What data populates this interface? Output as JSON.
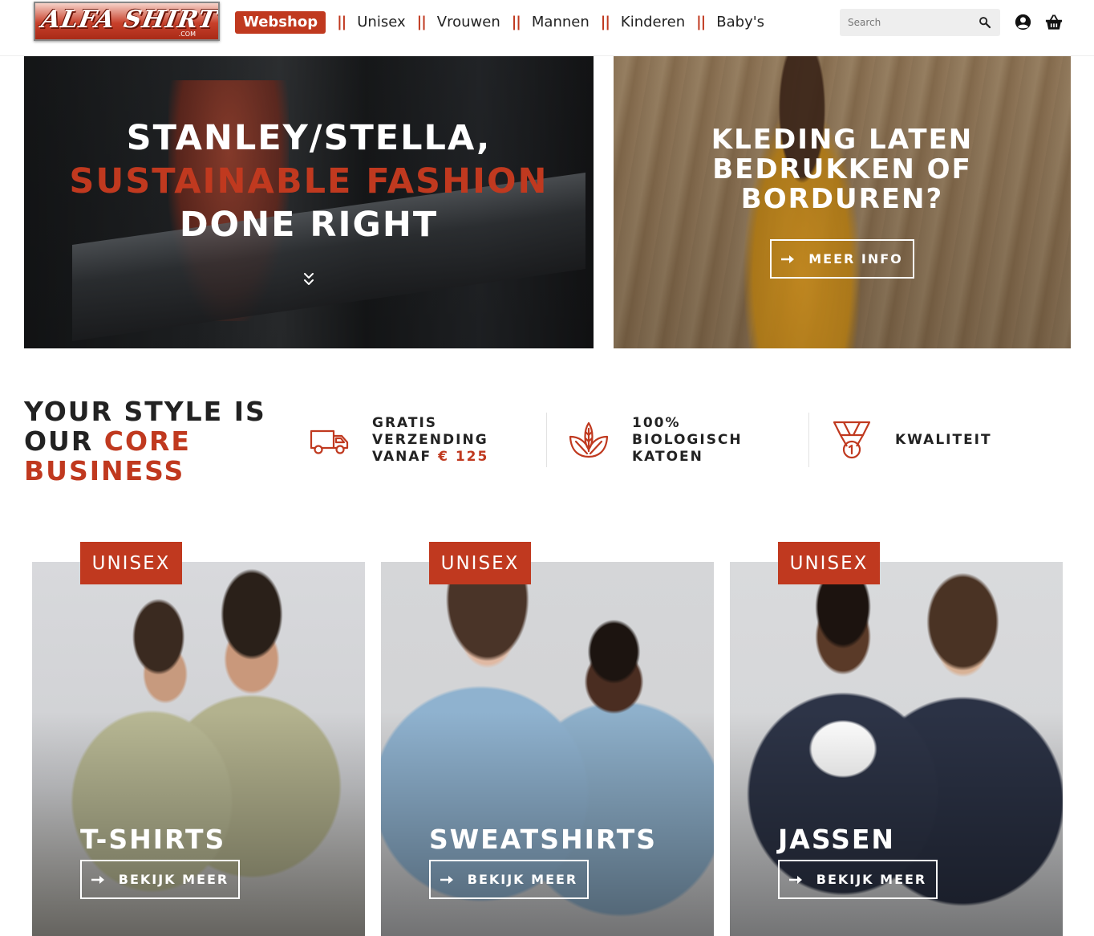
{
  "header": {
    "logo_text": "ALFA SHIRT",
    "logo_suffix": ".COM",
    "nav": [
      {
        "label": "Webshop",
        "active": true
      },
      {
        "label": "Unisex"
      },
      {
        "label": "Vrouwen"
      },
      {
        "label": "Mannen"
      },
      {
        "label": "Kinderen"
      },
      {
        "label": "Baby's"
      }
    ],
    "separator": "||",
    "search_placeholder": "Search",
    "icons": [
      "search-icon",
      "user-icon",
      "basket-icon"
    ]
  },
  "hero": {
    "left": {
      "line1": "STANLEY/STELLA,",
      "line2": "SUSTAINABLE FASHION",
      "line3": "DONE RIGHT"
    },
    "right": {
      "title_line1": "KLEDING LATEN",
      "title_line2": "BEDRUKKEN OF",
      "title_line3": "BORDUREN?",
      "button": "MEER INFO"
    }
  },
  "core": {
    "line1": "YOUR STYLE IS",
    "line2_dark": "OUR ",
    "line2_orange": "CORE",
    "line3_orange": "BUSINESS"
  },
  "features": [
    {
      "icon": "truck-icon",
      "line1": "GRATIS",
      "line2": "VERZENDING",
      "line3_dark": "VANAF ",
      "line3_orange": "€ 125"
    },
    {
      "icon": "leaf-icon",
      "line1": "100%",
      "line2": "BIOLOGISCH",
      "line3": "KATOEN"
    },
    {
      "icon": "medal-icon",
      "line1": "KWALITEIT"
    }
  ],
  "categories": [
    {
      "badge": "UNISEX",
      "title": "T-SHIRTS",
      "button": "BEKIJK MEER"
    },
    {
      "badge": "UNISEX",
      "title": "SWEATSHIRTS",
      "button": "BEKIJK MEER"
    },
    {
      "badge": "UNISEX",
      "title": "JASSEN",
      "button": "BEKIJK MEER"
    }
  ],
  "colors": {
    "accent": "#c0391f",
    "text": "#222222"
  }
}
